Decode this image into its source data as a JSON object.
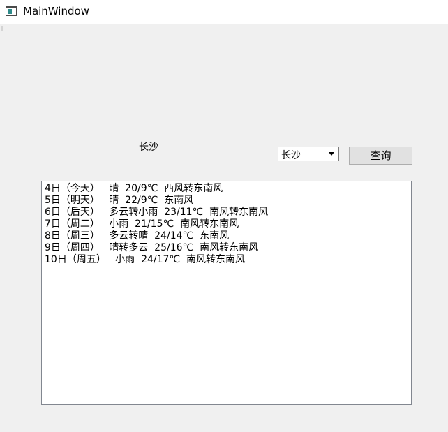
{
  "window": {
    "title": "MainWindow"
  },
  "main": {
    "city_label": "长沙",
    "combo_value": "长沙",
    "query_button": "查询",
    "forecast_lines": [
      "4日（今天）   晴  20/9℃  西风转东南风",
      "5日（明天）   晴  22/9℃  东南风",
      "6日（后天）   多云转小雨  23/11℃  南风转东南风",
      "7日（周二）   小雨  21/15℃  南风转东南风",
      "8日（周三）   多云转晴  24/14℃  东南风",
      "9日（周四）   晴转多云  25/16℃  南风转东南风",
      "10日（周五）   小雨  24/17℃  南风转东南风"
    ]
  },
  "icons": {
    "app": "app-window-icon",
    "combo": "chevron-down-icon",
    "toolbar": "toolbar-handle-icon"
  }
}
